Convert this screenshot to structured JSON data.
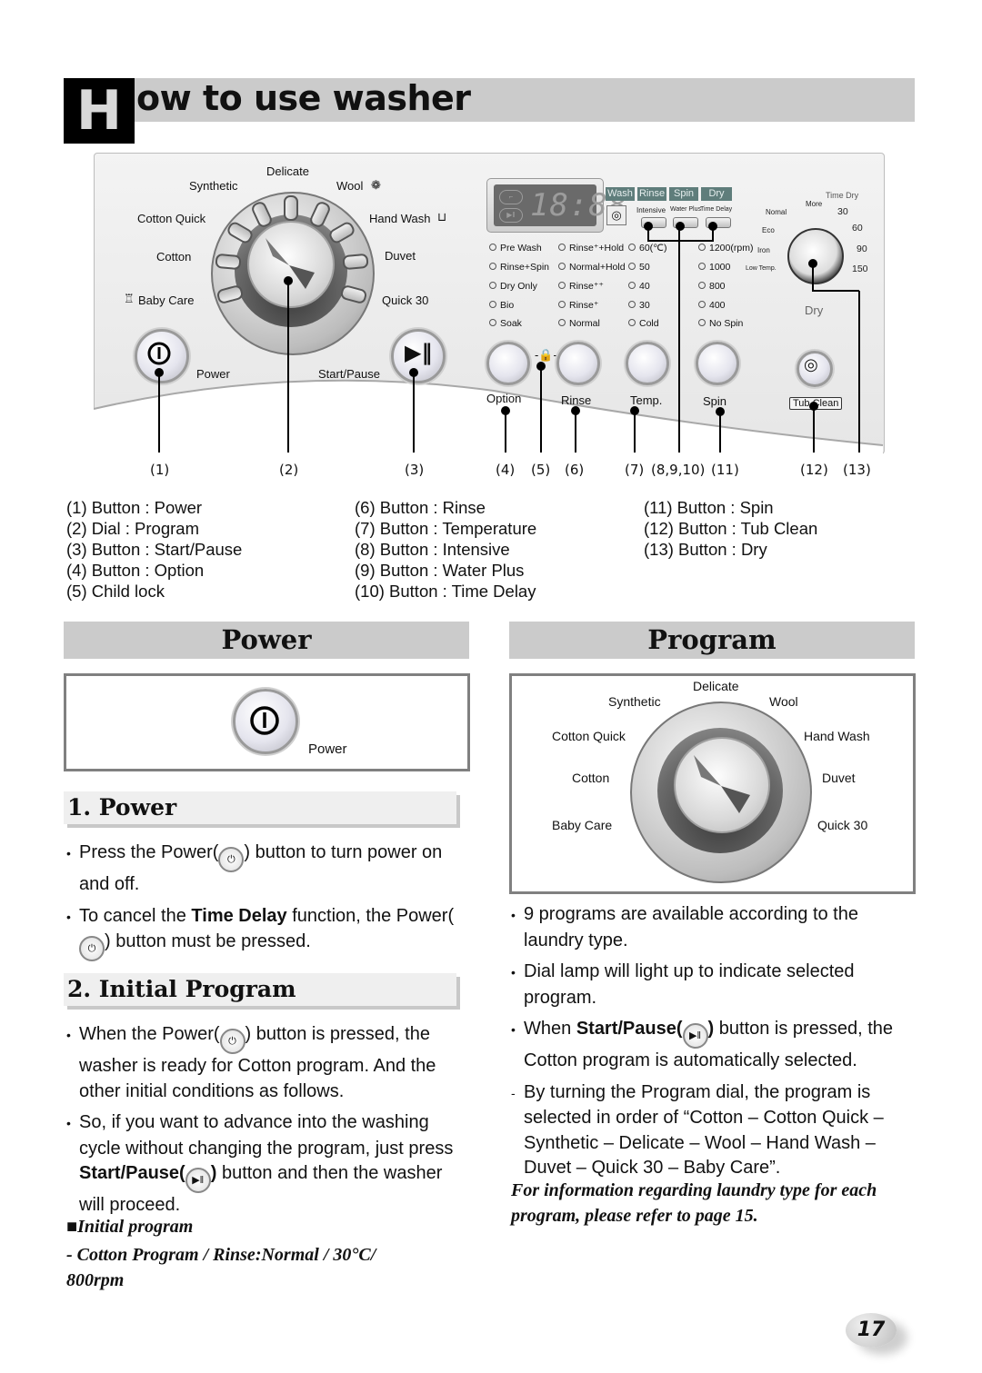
{
  "header": {
    "title_initial": "H",
    "title_rest": "ow to use washer"
  },
  "panel": {
    "program_dial_labels": {
      "delicate": "Delicate",
      "synthetic": "Synthetic",
      "wool": "Wool",
      "cotton_quick": "Cotton Quick",
      "hand_wash": "Hand Wash",
      "cotton": "Cotton",
      "duvet": "Duvet",
      "baby_care": "Baby Care",
      "quick30": "Quick 30"
    },
    "power_label": "Power",
    "start_pause_label": "Start/Pause",
    "display": {
      "digits": "18:88",
      "stages": [
        "Wash",
        "Rinse",
        "Spin",
        "Dry"
      ],
      "function_buttons": [
        "Intensive",
        "Water Plus",
        "Time Delay"
      ]
    },
    "option_column": [
      "Pre Wash",
      "Rinse+Spin",
      "Dry Only",
      "Bio",
      "Soak"
    ],
    "rinse_column": [
      "Rinse⁺+Hold",
      "Normal+Hold",
      "Rinse⁺⁺",
      "Rinse⁺",
      "Normal"
    ],
    "temp_column": [
      "60(℃)",
      "50",
      "40",
      "30",
      "Cold"
    ],
    "spin_column": [
      "1200(rpm)",
      "1000",
      "800",
      "400",
      "No Spin"
    ],
    "dry_dial": {
      "left": [
        "Nomal",
        "Eco",
        "Iron",
        "Low Temp."
      ],
      "top": "More",
      "time_dry_label": "Time Dry",
      "right": [
        "30",
        "60",
        "90",
        "150"
      ],
      "label": "Dry"
    },
    "bottom_buttons": [
      "Option",
      "Rinse",
      "Temp.",
      "Spin"
    ],
    "tub_clean_label": "Tub Clean",
    "callouts": [
      "(1)",
      "(2)",
      "(3)",
      "(4)",
      "(5)",
      "(6)",
      "(7)",
      "(8,9,10)",
      "(11)",
      "(12)",
      "(13)"
    ]
  },
  "legend": {
    "col1": [
      "(1) Button : Power",
      "(2) Dial : Program",
      "(3) Button : Start/Pause",
      "(4) Button : Option",
      "(5) Child lock"
    ],
    "col2": [
      "(6) Button : Rinse",
      "(7) Button : Temperature",
      "(8) Button : Intensive",
      "(9) Button : Water Plus",
      "(10) Button : Time Delay"
    ],
    "col3": [
      "(11) Button : Spin",
      "(12) Button : Tub Clean",
      "(13) Button : Dry"
    ]
  },
  "power_section": {
    "header": "Power",
    "figure_label": "Power",
    "sub1": "1. Power",
    "p1_a": "Press the Power(",
    "p1_b": ") button to turn power on and off.",
    "p2_a": "To cancel the ",
    "p2_bold": "Time Delay",
    "p2_b": " function, the Power(",
    "p2_c": ") button must be pressed.",
    "sub2": "2. Initial Program",
    "p3_a": "When the Power(",
    "p3_b": ") button is pressed, the washer is ready for Cotton program. And the other initial conditions as follows.",
    "p4_a": "So, if you want to advance into the washing cycle without changing the program, just press ",
    "p4_bold": "Start/Pause(",
    "p4_bold2": ")",
    "p4_b": " button and then the washer will proceed.",
    "note_title": "Initial program",
    "note_body": "- Cotton Program / Rinse:Normal / 30°C/ 800rpm"
  },
  "program_section": {
    "header": "Program",
    "p1": "9 programs are available according to the laundry type.",
    "p2": "Dial lamp will light up to indicate selected program.",
    "p3_a": "When ",
    "p3_bold": "Start/Pause(",
    "p3_bold2": ")",
    "p3_b": " button is pressed, the Cotton program is automatically selected.",
    "p4": "By turning the Program dial, the program is selected in order of  “Cotton – Cotton Quick – Synthetic – Delicate – Wool – Hand Wash – Duvet – Quick 30 – Baby Care”.",
    "note": "For information regarding laundry type for each program, please refer to page 15."
  },
  "page_number": "17"
}
